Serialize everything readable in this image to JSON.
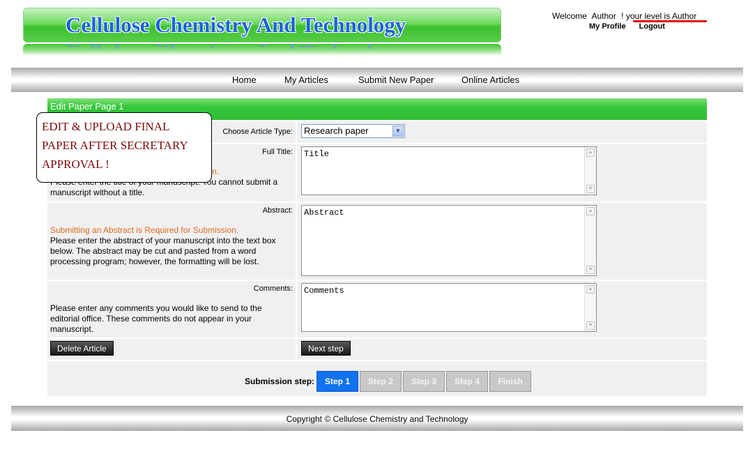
{
  "header": {
    "site_title": "Cellulose Chemistry And Technology",
    "welcome": "Welcome",
    "username": "Author",
    "level_text": "! your level is Author",
    "my_profile": "My Profile",
    "logout": "Logout"
  },
  "nav": {
    "items": [
      {
        "label": "Home"
      },
      {
        "label": "My Articles"
      },
      {
        "label": "Submit New Paper"
      },
      {
        "label": "Online Articles"
      }
    ]
  },
  "panel": {
    "title": "Edit Paper Page 1",
    "article_type": {
      "label": "Choose Article Type:",
      "value": "Research paper"
    },
    "full_title": {
      "label": "Full Title:",
      "required": "Submitting a Title is Required for Submission.",
      "help": "Please enter the title of your manuscript. You cannot submit a manuscript without a title.",
      "value": "Title"
    },
    "abstract": {
      "label": "Abstract:",
      "required": "Submitting an Abstract is Required for Submission.",
      "help": "Please enter the abstract of your manuscript into the text box below. The abstract may be cut and pasted from a word processing program; however, the formatting will be lost.",
      "value": "Abstract"
    },
    "comments": {
      "label": "Comments:",
      "help": "Please enter any comments you would like to send to the editorial office. These comments do not appear in your manuscript.",
      "value": "Comments"
    },
    "delete_button": "Delete Article",
    "next_button": "Next step",
    "steps": {
      "label": "Submission step:",
      "items": [
        "Step 1",
        "Step 2",
        "Step 3",
        "Step 4",
        "Finish"
      ],
      "active_index": 0
    }
  },
  "callout": {
    "text": "EDIT & UPLOAD FINAL PAPER AFTER SECRETARY APPROVAL !"
  },
  "footer": {
    "copyright": "Copyright © Cellulose Chemistry and Technology"
  },
  "colors": {
    "header_green": "#3ec12f",
    "title_blue": "#1a63d8",
    "required_orange": "#e26a1c",
    "step_active": "#1172f2",
    "callout_text": "#7b0a0a"
  },
  "icons": {
    "select_arrow": "chevron-down-icon",
    "scroll_up": "scroll-up-icon",
    "scroll_down": "scroll-down-icon"
  }
}
